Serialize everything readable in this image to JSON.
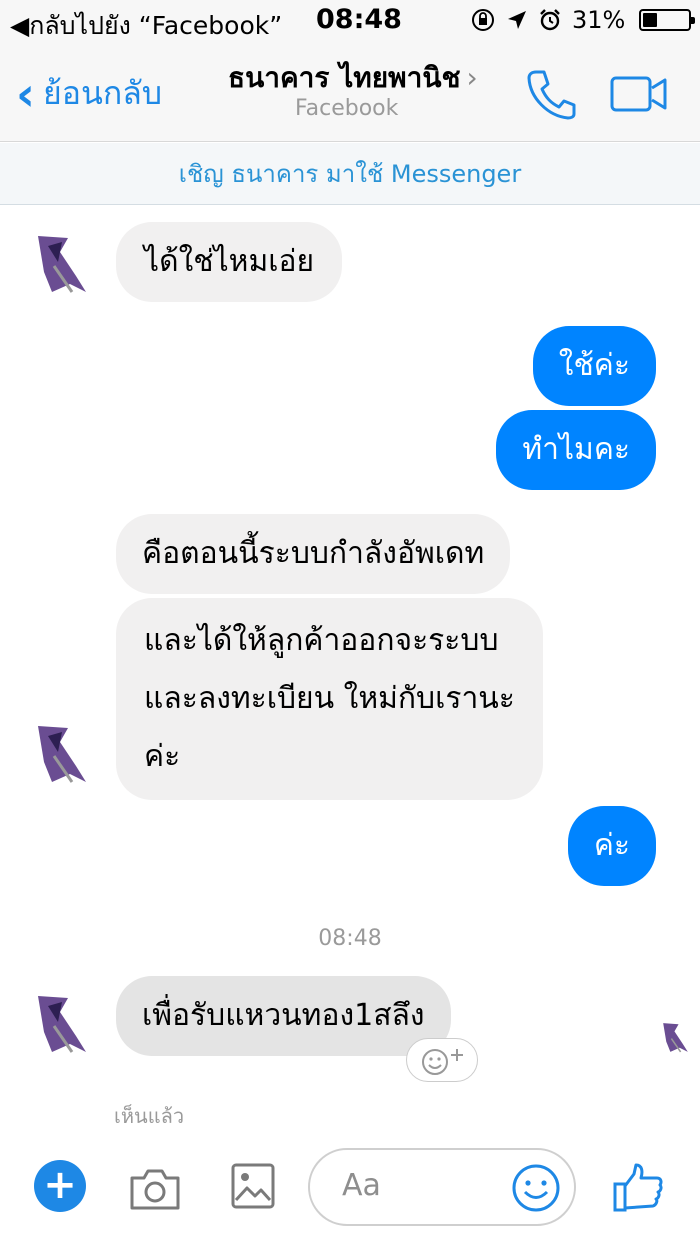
{
  "status_bar": {
    "back_label": "◀กลับไปยัง “Facebook”",
    "time": "08:48",
    "battery": "31%",
    "battery_level": 0.31
  },
  "nav": {
    "back_label": "ย้อนกลับ",
    "title": "ธนาคาร ไทยพานิช",
    "subtitle": "Facebook"
  },
  "invite_banner": "เชิญ ธนาคาร มาใช้ Messenger",
  "messages": [
    {
      "direction": "in",
      "text": "ได้ใช่ไหมเอ่ย"
    },
    {
      "direction": "out",
      "text": "ใช้ค่ะ"
    },
    {
      "direction": "out",
      "text": "ทำไมคะ"
    },
    {
      "direction": "in",
      "text": "คือตอนนี้ระบบกำลังอัพเดท"
    },
    {
      "direction": "in",
      "lines": [
        "และได้ให้ลูกค้าออกจะระบบ",
        "และลงทะเบียน ใหม่กับเรานะ",
        "ค่ะ"
      ]
    },
    {
      "direction": "out",
      "text": "ค่ะ"
    },
    {
      "direction": "in",
      "text": "เพื่อรับแหวนทอง1สลึง"
    }
  ],
  "timestamp": "08:48",
  "seen_label": "เห็นแล้ว",
  "composer": {
    "placeholder": "Aa"
  },
  "icons": {
    "plus": "plus-icon",
    "camera": "camera-icon",
    "gallery": "image-icon",
    "emoji": "smiley-icon",
    "like": "thumbs-up-icon",
    "phone": "phone-icon",
    "video": "video-icon"
  },
  "colors": {
    "accent": "#0084ff",
    "incoming_bubble": "#f1f0f0",
    "banner_text": "#2a93d5"
  }
}
